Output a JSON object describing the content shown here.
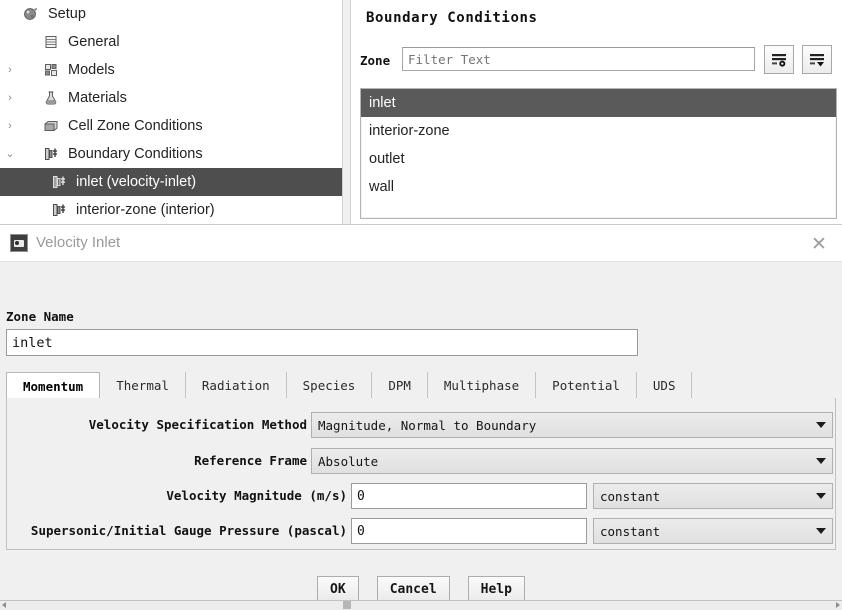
{
  "outline_tree": {
    "items": [
      {
        "label": "Setup",
        "icon": "setup-icon",
        "indent": 0,
        "arrow": "",
        "selected": false
      },
      {
        "label": "General",
        "icon": "general-icon",
        "indent": 1,
        "arrow": "",
        "selected": false
      },
      {
        "label": "Models",
        "icon": "models-icon",
        "indent": 1,
        "arrow": "›",
        "selected": false
      },
      {
        "label": "Materials",
        "icon": "materials-icon",
        "indent": 1,
        "arrow": "›",
        "selected": false
      },
      {
        "label": "Cell Zone Conditions",
        "icon": "cellzone-icon",
        "indent": 1,
        "arrow": "›",
        "selected": false
      },
      {
        "label": "Boundary Conditions",
        "icon": "boundary-icon",
        "indent": 1,
        "arrow": "⌄",
        "selected": false
      },
      {
        "label": "inlet (velocity-inlet)",
        "icon": "boundary-icon",
        "indent": 2,
        "arrow": "",
        "selected": true
      },
      {
        "label": "interior-zone (interior)",
        "icon": "boundary-icon",
        "indent": 2,
        "arrow": "",
        "selected": false
      }
    ]
  },
  "boundary_conditions_panel": {
    "title": "Boundary Conditions",
    "zone_label": "Zone",
    "filter_placeholder": "Filter Text",
    "filter_value": "",
    "toolbar": {
      "sort_button": "sort-list-icon",
      "options_button": "list-options-icon"
    },
    "zones": [
      {
        "name": "inlet",
        "selected": true
      },
      {
        "name": "interior-zone",
        "selected": false
      },
      {
        "name": "outlet",
        "selected": false
      },
      {
        "name": "wall",
        "selected": false
      }
    ]
  },
  "dialog": {
    "title": "Velocity Inlet",
    "icon": "velocity-inlet-icon",
    "close_label": "✕",
    "zone_name_label": "Zone Name",
    "zone_name_value": "inlet",
    "tabs": [
      {
        "label": "Momentum",
        "active": true
      },
      {
        "label": "Thermal",
        "active": false
      },
      {
        "label": "Radiation",
        "active": false
      },
      {
        "label": "Species",
        "active": false
      },
      {
        "label": "DPM",
        "active": false
      },
      {
        "label": "Multiphase",
        "active": false
      },
      {
        "label": "Potential",
        "active": false
      },
      {
        "label": "UDS",
        "active": false
      }
    ],
    "fields": [
      {
        "label": "Velocity Specification Method",
        "type": "combo",
        "value": "Magnitude, Normal to Boundary"
      },
      {
        "label": "Reference Frame",
        "type": "combo",
        "value": "Absolute"
      },
      {
        "label": "Velocity Magnitude (m/s)",
        "type": "input-combo",
        "value": "0",
        "profile": "constant"
      },
      {
        "label": "Supersonic/Initial Gauge Pressure (pascal)",
        "type": "input-combo",
        "value": "0",
        "profile": "constant"
      }
    ],
    "buttons": [
      {
        "label": "OK"
      },
      {
        "label": "Cancel"
      },
      {
        "label": "Help"
      }
    ]
  },
  "colors": {
    "tree_selection": "#4e4e4e",
    "list_selection": "#5a5a5a",
    "dialog_background": "#f0f0f0",
    "panel_background": "#ffffff"
  }
}
